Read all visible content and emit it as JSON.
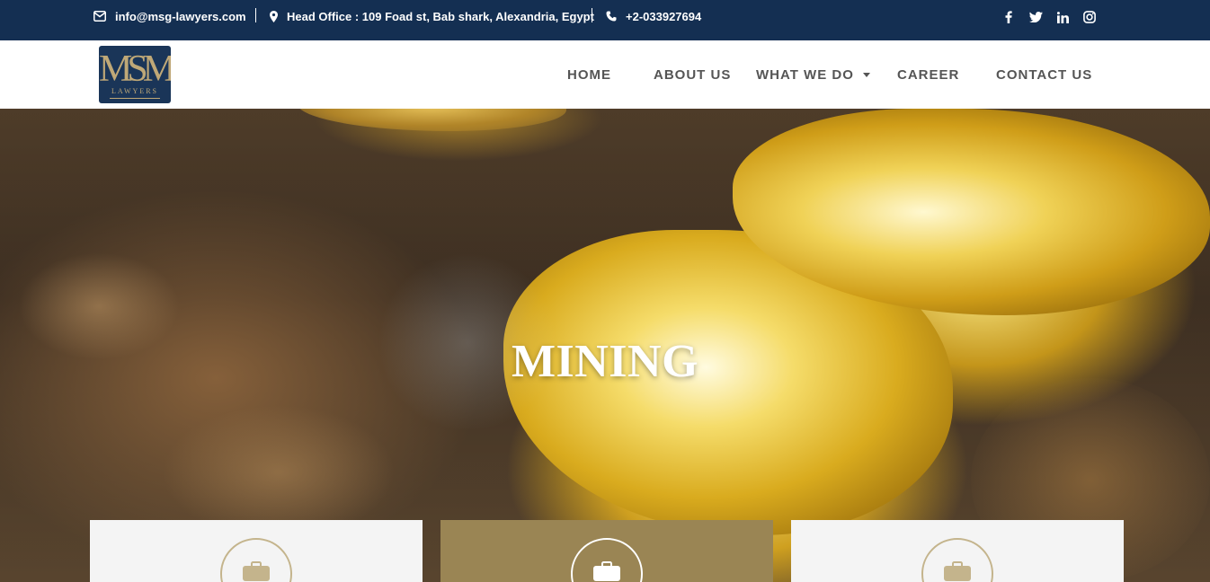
{
  "topbar": {
    "email": "info@msg-lawyers.com",
    "address": "Head Office : 109 Foad st, Bab shark, Alexandria, Egypt",
    "phone": "+2-033927694",
    "social": [
      "facebook-icon",
      "twitter-icon",
      "linkedin-icon",
      "instagram-icon"
    ],
    "background": "#142f52"
  },
  "logo": {
    "monogram": "MSM",
    "text": "LAWYERS",
    "background": "#1a3558",
    "accent": "#bfa877"
  },
  "nav": {
    "home": "HOME",
    "about": "ABOUT US",
    "what_we_do": "WHAT WE DO",
    "career": "CAREER",
    "contact": "CONTACT US"
  },
  "hero": {
    "title": "MINING"
  },
  "cards": [
    {
      "icon": "briefcase-icon",
      "background": "#f4f4f4"
    },
    {
      "icon": "briefcase-icon",
      "background": "#9a8554"
    },
    {
      "icon": "briefcase-icon",
      "background": "#f4f4f4"
    }
  ]
}
